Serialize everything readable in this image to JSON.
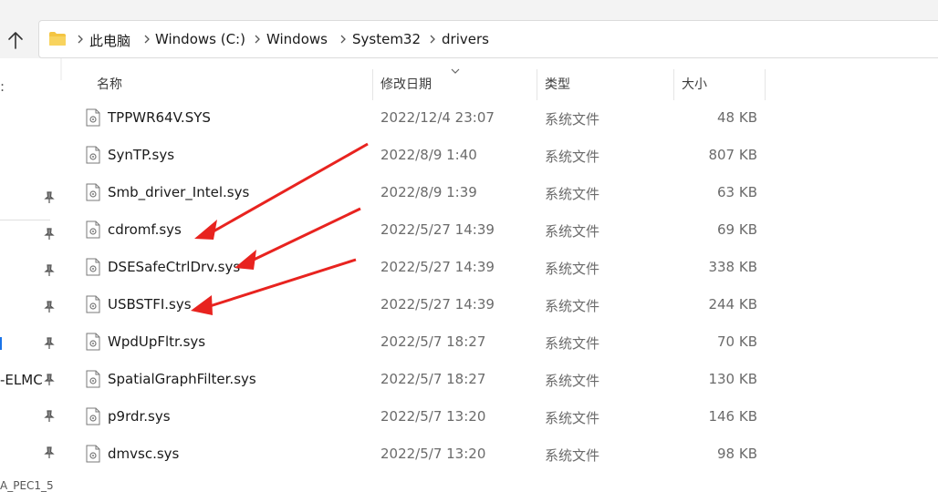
{
  "breadcrumb": [
    "此电脑",
    "Windows (C:)",
    "Windows",
    "System32",
    "drivers"
  ],
  "columns": {
    "name": "名称",
    "date": "修改日期",
    "type": "类型",
    "size": "大小"
  },
  "files": [
    {
      "name": "TPPWR64V.SYS",
      "date": "2022/12/4 23:07",
      "type": "系统文件",
      "size": "48 KB"
    },
    {
      "name": "SynTP.sys",
      "date": "2022/8/9 1:40",
      "type": "系统文件",
      "size": "807 KB"
    },
    {
      "name": "Smb_driver_Intel.sys",
      "date": "2022/8/9 1:39",
      "type": "系统文件",
      "size": "63 KB"
    },
    {
      "name": "cdromf.sys",
      "date": "2022/5/27 14:39",
      "type": "系统文件",
      "size": "69 KB"
    },
    {
      "name": "DSESafeCtrlDrv.sys",
      "date": "2022/5/27 14:39",
      "type": "系统文件",
      "size": "338 KB"
    },
    {
      "name": "USBSTFI.sys",
      "date": "2022/5/27 14:39",
      "type": "系统文件",
      "size": "244 KB"
    },
    {
      "name": "WpdUpFltr.sys",
      "date": "2022/5/7 18:27",
      "type": "系统文件",
      "size": "70 KB"
    },
    {
      "name": "SpatialGraphFilter.sys",
      "date": "2022/5/7 18:27",
      "type": "系统文件",
      "size": "130 KB"
    },
    {
      "name": "p9rdr.sys",
      "date": "2022/5/7 13:20",
      "type": "系统文件",
      "size": "146 KB"
    },
    {
      "name": "dmvsc.sys",
      "date": "2022/5/7 13:20",
      "type": "系统文件",
      "size": "98 KB"
    }
  ],
  "nav": {
    "partial_label": "-ELMC",
    "partial_label_2": "A_PEC1_5"
  },
  "colors": {
    "annotation_arrow": "#e8231f",
    "folder": "#f4c542"
  }
}
